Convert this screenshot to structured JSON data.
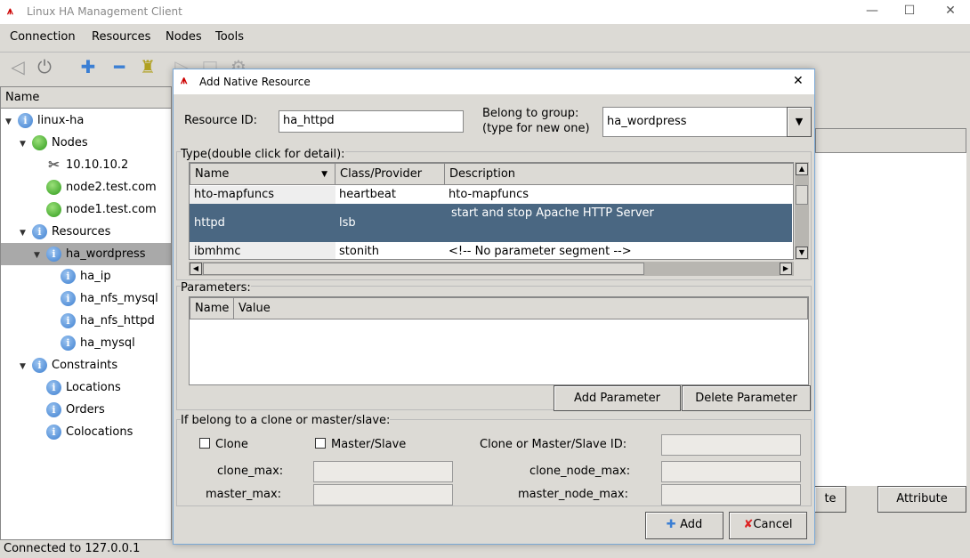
{
  "window": {
    "title": "Linux HA Management Client",
    "minimize": "—",
    "maximize": "☐",
    "close": "✕"
  },
  "menu": [
    "Connection",
    "Resources",
    "Nodes",
    "Tools"
  ],
  "toolbar": [
    {
      "icon": "connect-icon"
    },
    {
      "icon": "disconnect-icon"
    },
    {
      "icon": "add-icon",
      "glyph": "✚",
      "color": "#3b7fd4"
    },
    {
      "icon": "remove-icon",
      "glyph": "━",
      "color": "#3b7fd4"
    },
    {
      "icon": "cleanup-icon"
    },
    {
      "icon": "start-icon"
    },
    {
      "icon": "stop-icon"
    },
    {
      "icon": "settings-icon"
    }
  ],
  "tree": {
    "header": "Name",
    "items": [
      {
        "label": "linux-ha",
        "level": 0,
        "icon": "info",
        "arrow": "▼"
      },
      {
        "label": "Nodes",
        "level": 1,
        "icon": "green",
        "arrow": "▼"
      },
      {
        "label": "10.10.10.2",
        "level": 2,
        "icon": "tools"
      },
      {
        "label": "node2.test.com",
        "level": 2,
        "icon": "green"
      },
      {
        "label": "node1.test.com",
        "level": 2,
        "icon": "green"
      },
      {
        "label": "Resources",
        "level": 1,
        "icon": "info",
        "arrow": "▼"
      },
      {
        "label": "ha_wordpress",
        "level": 2,
        "icon": "info",
        "arrow": "▼",
        "selected": true
      },
      {
        "label": "ha_ip",
        "level": 3,
        "icon": "info"
      },
      {
        "label": "ha_nfs_mysql",
        "level": 3,
        "icon": "info"
      },
      {
        "label": "ha_nfs_httpd",
        "level": 3,
        "icon": "info"
      },
      {
        "label": "ha_mysql",
        "level": 3,
        "icon": "info"
      },
      {
        "label": "Constraints",
        "level": 1,
        "icon": "info",
        "arrow": "▼"
      },
      {
        "label": "Locations",
        "level": 2,
        "icon": "info"
      },
      {
        "label": "Orders",
        "level": 2,
        "icon": "info"
      },
      {
        "label": "Colocations",
        "level": 2,
        "icon": "info"
      }
    ]
  },
  "background_buttons": [
    "te",
    "Attribute"
  ],
  "status": "Connected to 127.0.0.1",
  "dialog": {
    "title": "Add Native Resource",
    "close": "✕",
    "resource_id_label": "Resource ID:",
    "resource_id": "ha_httpd",
    "group_label_1": "Belong to group:",
    "group_label_2": "(type for new one)",
    "group_value": "ha_wordpress",
    "type_label": "Type(double click for detail):",
    "type_columns": [
      "Name",
      "Class/Provider",
      "Description"
    ],
    "type_rows": [
      {
        "name": "hto-mapfuncs",
        "class": "heartbeat",
        "desc": "hto-mapfuncs"
      },
      {
        "name": "httpd",
        "class": "lsb",
        "desc": "start and stop Apache HTTP Server",
        "selected": true
      },
      {
        "name": "ibmhmc",
        "class": "stonith",
        "desc": "<!-- No parameter segment -->"
      }
    ],
    "params_label": "Parameters:",
    "param_columns": [
      "Name",
      "Value"
    ],
    "add_param": "Add Parameter",
    "delete_param": "Delete Parameter",
    "clone_label": "If belong to a clone or master/slave:",
    "clone_cb": "Clone",
    "master_cb": "Master/Slave",
    "clone_id_label": "Clone or Master/Slave ID:",
    "clone_max": "clone_max:",
    "master_max": "master_max:",
    "clone_node_max": "clone_node_max:",
    "master_node_max": "master_node_max:",
    "add": "Add",
    "cancel": "Cancel"
  },
  "colors": {
    "selection": "#4a6782",
    "tree_selection": "#a9a9a9"
  }
}
